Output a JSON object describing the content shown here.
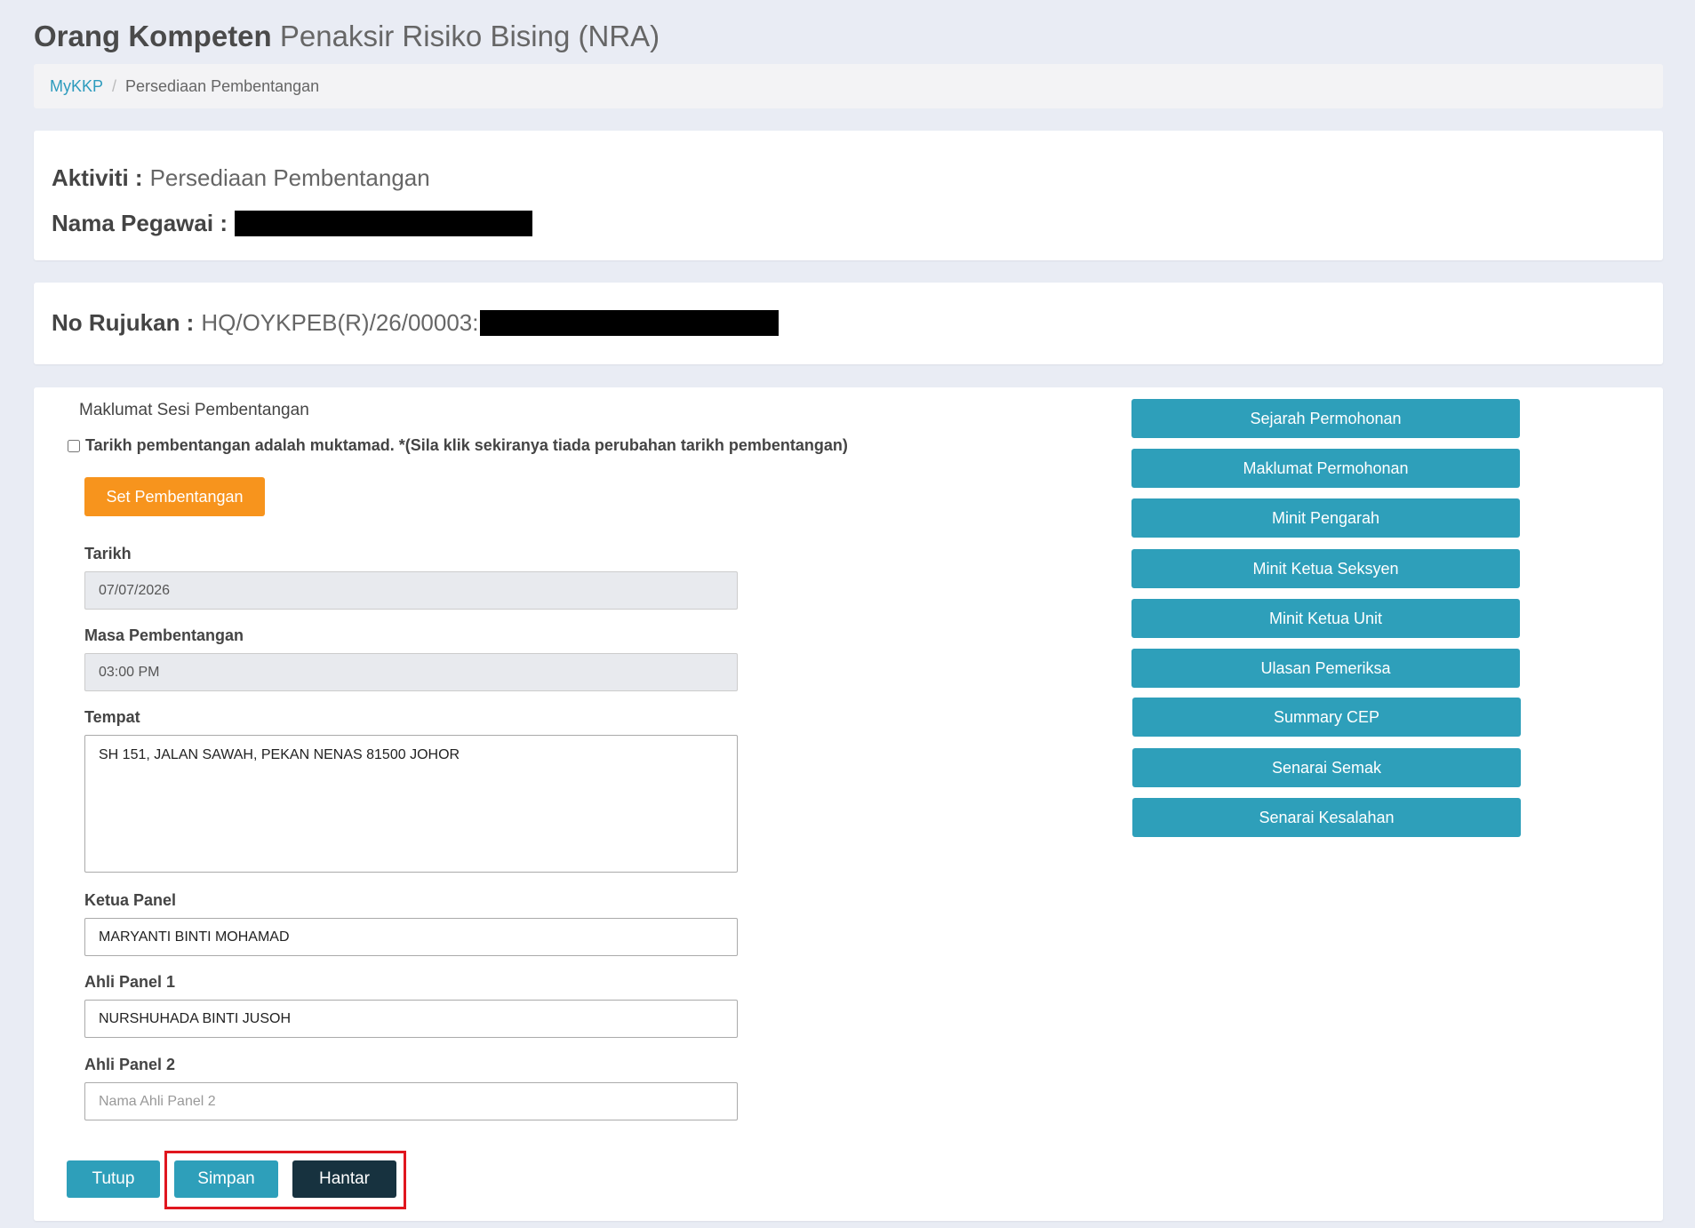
{
  "header": {
    "title_bold": "Orang Kompeten",
    "title_rest": "Penaksir Risiko Bising (NRA)"
  },
  "breadcrumb": {
    "home": "MyKKP",
    "separator": "/",
    "current": "Persediaan Pembentangan"
  },
  "info": {
    "aktiviti_label": "Aktiviti :",
    "aktiviti_value": "Persediaan Pembentangan",
    "nama_label": "Nama Pegawai :",
    "rujukan_label": "No Rujukan :",
    "rujukan_value": "HQ/OYKPEB(R)/26/00003:"
  },
  "form": {
    "section_title": "Maklumat Sesi Pembentangan",
    "confirm_text": "Tarikh pembentangan adalah muktamad. *(Sila klik sekiranya tiada perubahan tarikh pembentangan)",
    "confirm_checked": false,
    "set_button": "Set Pembentangan",
    "tarikh_label": "Tarikh",
    "tarikh_value": "07/07/2026",
    "masa_label": "Masa Pembentangan",
    "masa_value": "03:00 PM",
    "tempat_label": "Tempat",
    "tempat_value": "SH 151, JALAN SAWAH, PEKAN NENAS 81500 JOHOR",
    "ketua_label": "Ketua Panel",
    "ketua_value": "MARYANTI BINTI MOHAMAD",
    "ahli1_label": "Ahli Panel 1",
    "ahli1_value": "NURSHUHADA BINTI JUSOH",
    "ahli2_label": "Ahli Panel 2",
    "ahli2_placeholder": "Nama Ahli Panel 2"
  },
  "sidebar": {
    "buttons": [
      "Sejarah Permohonan",
      "Maklumat Permohonan",
      "Minit Pengarah",
      "Minit Ketua Seksyen",
      "Minit Ketua Unit",
      "Ulasan Pemeriksa",
      "Summary CEP",
      "Senarai Semak",
      "Senarai Kesalahan"
    ]
  },
  "actions": {
    "tutup": "Tutup",
    "simpan": "Simpan",
    "hantar": "Hantar"
  },
  "colors": {
    "primary": "#2e9fba",
    "orange": "#f7941d",
    "dark": "#17323f",
    "highlight": "#e0161e",
    "background": "#e9ecf4"
  }
}
